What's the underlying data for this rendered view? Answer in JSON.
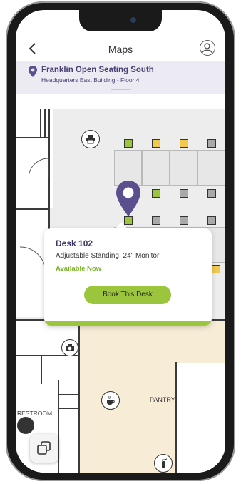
{
  "header": {
    "title": "Maps",
    "back_icon": "chevron-left-icon",
    "profile_icon": "user-circle-icon"
  },
  "location": {
    "name": "Franklin Open Seating South",
    "subtitle": "Headquarters East Building - Floor 4",
    "icon": "map-pin-icon"
  },
  "map": {
    "rooms": {
      "pantry": "PANTRY",
      "restroom": "RESTROOM"
    },
    "icons": [
      "printer-icon",
      "camera-icon",
      "coffee-cup-icon",
      "fire-extinguisher-icon",
      "accessible-icon"
    ]
  },
  "popup": {
    "desk_name": "Desk 102",
    "description": "Adjustable Standing, 24\" Monitor",
    "availability": "Available Now",
    "book_label": "Book This Desk"
  },
  "colors": {
    "accent_green": "#9bc53d",
    "brand_purple": "#5b4f8e",
    "available_text": "#7ab428",
    "desk_yellow": "#f2c94c"
  },
  "controls": {
    "layers_icon": "layers-icon"
  }
}
